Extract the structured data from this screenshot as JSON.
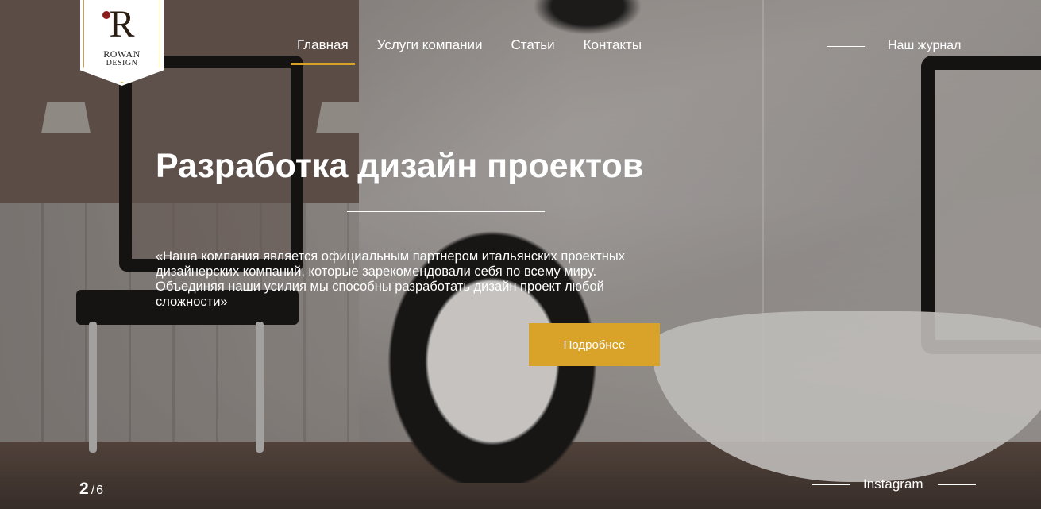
{
  "brand": {
    "logo_letter": "R",
    "logo_line1": "ROWAN",
    "logo_line2": "DESIGN",
    "accent_color": "#d9a228"
  },
  "nav": {
    "items": [
      {
        "label": "Главная",
        "active": true
      },
      {
        "label": "Услуги компании",
        "active": false
      },
      {
        "label": "Статьи",
        "active": false
      },
      {
        "label": "Контакты",
        "active": false
      }
    ],
    "journal_label": "Наш журнал"
  },
  "hero": {
    "title": "Разработка дизайн проектов",
    "description": "«Наша компания является официальным партнером итальянских проектных дизайнерских компаний, которые зарекомендовали себя по всему миру. Объединяя наши усилия мы способны разработать дизайн проект любой сложности»",
    "cta_label": "Подробнее"
  },
  "pager": {
    "current": "2",
    "separator": "/",
    "total": "6"
  },
  "social": {
    "instagram_label": "Instagram"
  }
}
